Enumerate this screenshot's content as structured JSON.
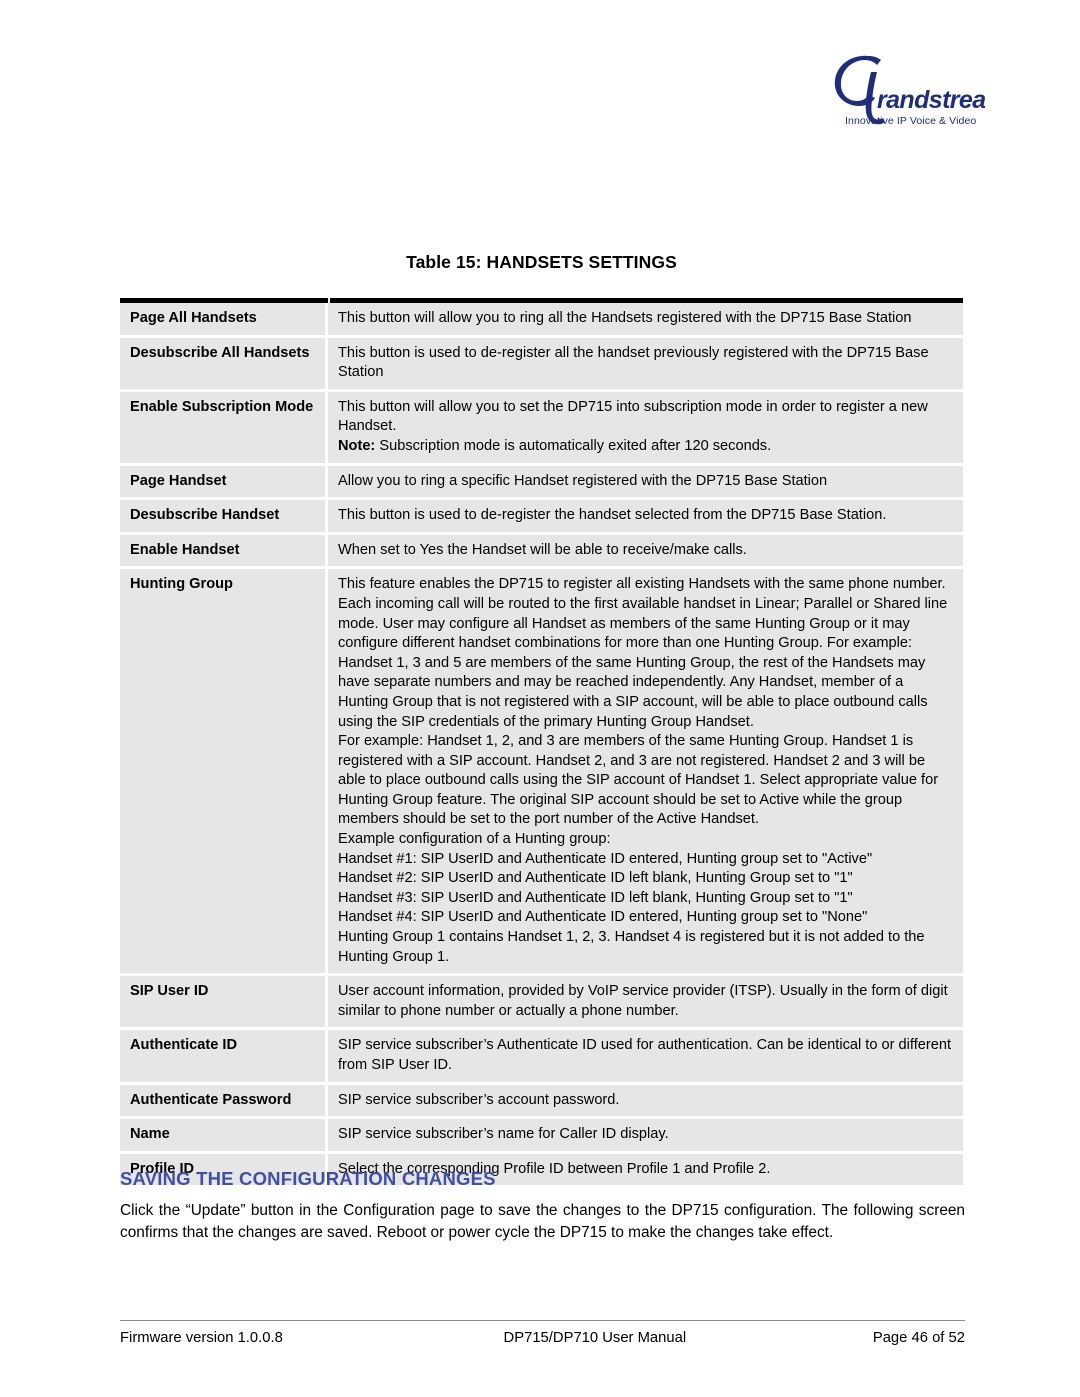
{
  "logo": {
    "brand": "randstream",
    "monogram": "G",
    "tagline": "Innovative IP Voice & Video",
    "color": "#1f2e7a"
  },
  "table": {
    "caption_prefix": "Table 15:",
    "caption_title": "HANDSETS SETTINGS",
    "caption_full": "Table 15: HANDSETS SETTINGS",
    "rows": [
      {
        "label": "Page All Handsets",
        "lines": [
          "This button will allow you to ring all the Handsets registered with the DP715 Base Station"
        ]
      },
      {
        "label": "Desubscribe All Handsets",
        "lines": [
          "This button is used to de-register all the handset previously registered with the DP715 Base Station"
        ]
      },
      {
        "label": "Enable Subscription Mode",
        "lines": [
          "This button will allow you to set the DP715 into subscription mode in order to register a new Handset."
        ],
        "note_lead": "Note:",
        "note_text": " Subscription mode is automatically exited after 120 seconds."
      },
      {
        "label": "Page Handset",
        "lines": [
          "Allow you to ring a specific Handset registered with the DP715 Base Station"
        ]
      },
      {
        "label": "Desubscribe Handset",
        "lines": [
          "This button is used to de-register the handset selected from the DP715 Base Station."
        ]
      },
      {
        "label": "Enable Handset",
        "lines": [
          "When set to Yes the Handset will be able to receive/make calls."
        ]
      },
      {
        "label": "Hunting Group",
        "lines": [
          "This feature enables the DP715 to register all existing Handsets with the same phone number. Each incoming call will be routed to the first available handset in Linear; Parallel or Shared line mode. User may configure all Handset as members of the same Hunting Group or it may configure different handset combinations for more than one Hunting Group. For example: Handset 1, 3 and 5 are members of the same Hunting Group, the rest of the Handsets may have separate numbers and may be reached independently. Any Handset, member of a Hunting Group that is not registered with a SIP account, will be able to place outbound calls using the SIP credentials of the primary Hunting Group Handset.",
          "For example: Handset 1,  2, and 3 are members of the same Hunting Group. Handset 1 is registered with a SIP account. Handset 2, and 3 are not registered. Handset 2 and 3 will be able to place outbound calls using the SIP account of Handset 1. Select appropriate value for Hunting Group feature. The original SIP account should be set to Active while the group members should be set to the port number of the Active Handset.",
          "Example configuration of a  Hunting group:",
          "Handset #1: SIP UserID and Authenticate ID entered, Hunting group set to \"Active\"",
          "Handset #2: SIP UserID and Authenticate ID left blank, Hunting Group set to \"1\"",
          "Handset #3: SIP UserID and Authenticate ID left blank, Hunting Group set to \"1\"",
          "Handset #4: SIP UserID and Authenticate ID entered, Hunting group set to \"None\"",
          "Hunting Group 1 contains Handset 1, 2, 3. Handset 4 is registered but it is not added to the Hunting Group 1."
        ]
      },
      {
        "label": "SIP User ID",
        "lines": [
          "User account information, provided by VoIP service provider (ITSP). Usually in the form of digit similar to phone number or actually a phone number."
        ]
      },
      {
        "label": "Authenticate ID",
        "lines": [
          "SIP service subscriber’s Authenticate ID used for authentication. Can be identical to or different from SIP User ID."
        ]
      },
      {
        "label": "Authenticate Password",
        "lines": [
          "SIP service subscriber’s account password."
        ]
      },
      {
        "label": "Name",
        "lines": [
          "SIP service subscriber’s name for Caller ID display."
        ]
      },
      {
        "label": "Profile ID",
        "lines": [
          "Select the corresponding Profile ID between Profile 1 and Profile 2."
        ]
      }
    ]
  },
  "section": {
    "heading": "SAVING THE CONFIGURATION CHANGES",
    "heading_color": "#3f4fa8",
    "paragraph": "Click the “Update” button in the Configuration page to save the changes to the DP715 configuration. The following screen confirms that the changes are saved.  Reboot or power cycle the DP715 to make the changes take effect."
  },
  "footer": {
    "firmware": "Firmware version 1.0.0.8",
    "manual": "DP715/DP710 User Manual",
    "page": "Page 46 of 52"
  }
}
